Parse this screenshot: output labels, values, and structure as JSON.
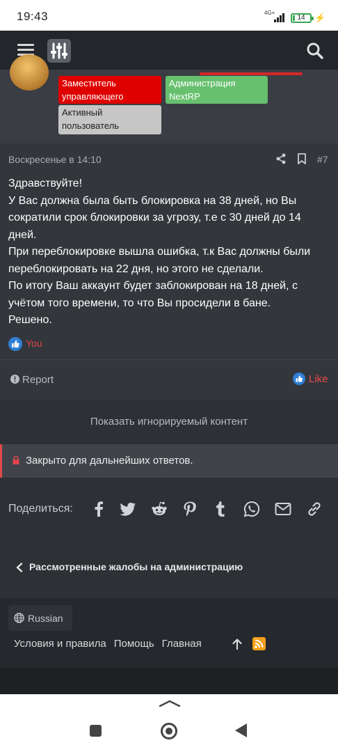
{
  "status_bar": {
    "time": "19:43",
    "network": "4G+",
    "battery": "14"
  },
  "navbar": {
    "menu_icon": "hamburger-menu-icon",
    "logo_icon": "sliders-logo-icon",
    "search_icon": "search-icon"
  },
  "user": {
    "badges": [
      {
        "label": "Заместитель управляющего",
        "color": "#df0000"
      },
      {
        "label": "Администрация NextRP",
        "color": "#67c06e"
      },
      {
        "label": "Активный пользователь",
        "color": "#c6c6c6"
      }
    ]
  },
  "post": {
    "date": "Воскресенье в 14:10",
    "number": "#7",
    "body": [
      "Здравствуйте!",
      "У Вас должна была быть блокировка на 38 дней, но Вы сократили срок блокировки за угрозу, т.е с 30 дней до 14 дней.",
      "При переблокировке вышла ошибка, т.к Вас должны были переблокировать на 22 дня, но этого не сделали.",
      "По итогу Ваш аккаунт будет заблокирован на 18 дней, с учётом того времени, то что Вы просидели в бане.",
      "Решено."
    ],
    "reaction_user": "You",
    "report_label": "Report",
    "like_label": "Like"
  },
  "ignored_content": "Показать игнорируемый контент",
  "closed_notice": "Закрыто для дальнейших ответов.",
  "share": {
    "label": "Поделиться:",
    "icons": [
      "facebook-icon",
      "twitter-icon",
      "reddit-icon",
      "pinterest-icon",
      "tumblr-icon",
      "whatsapp-icon",
      "email-icon",
      "link-icon"
    ]
  },
  "back_link": "Рассмотренные жалобы на администрацию",
  "footer": {
    "language": "Russian",
    "links": [
      "Условия и правила",
      "Помощь",
      "Главная"
    ]
  },
  "colors": {
    "accent_red": "#e0484b",
    "like_blue": "#2f7fd6",
    "rss_orange": "#f5a01a"
  }
}
